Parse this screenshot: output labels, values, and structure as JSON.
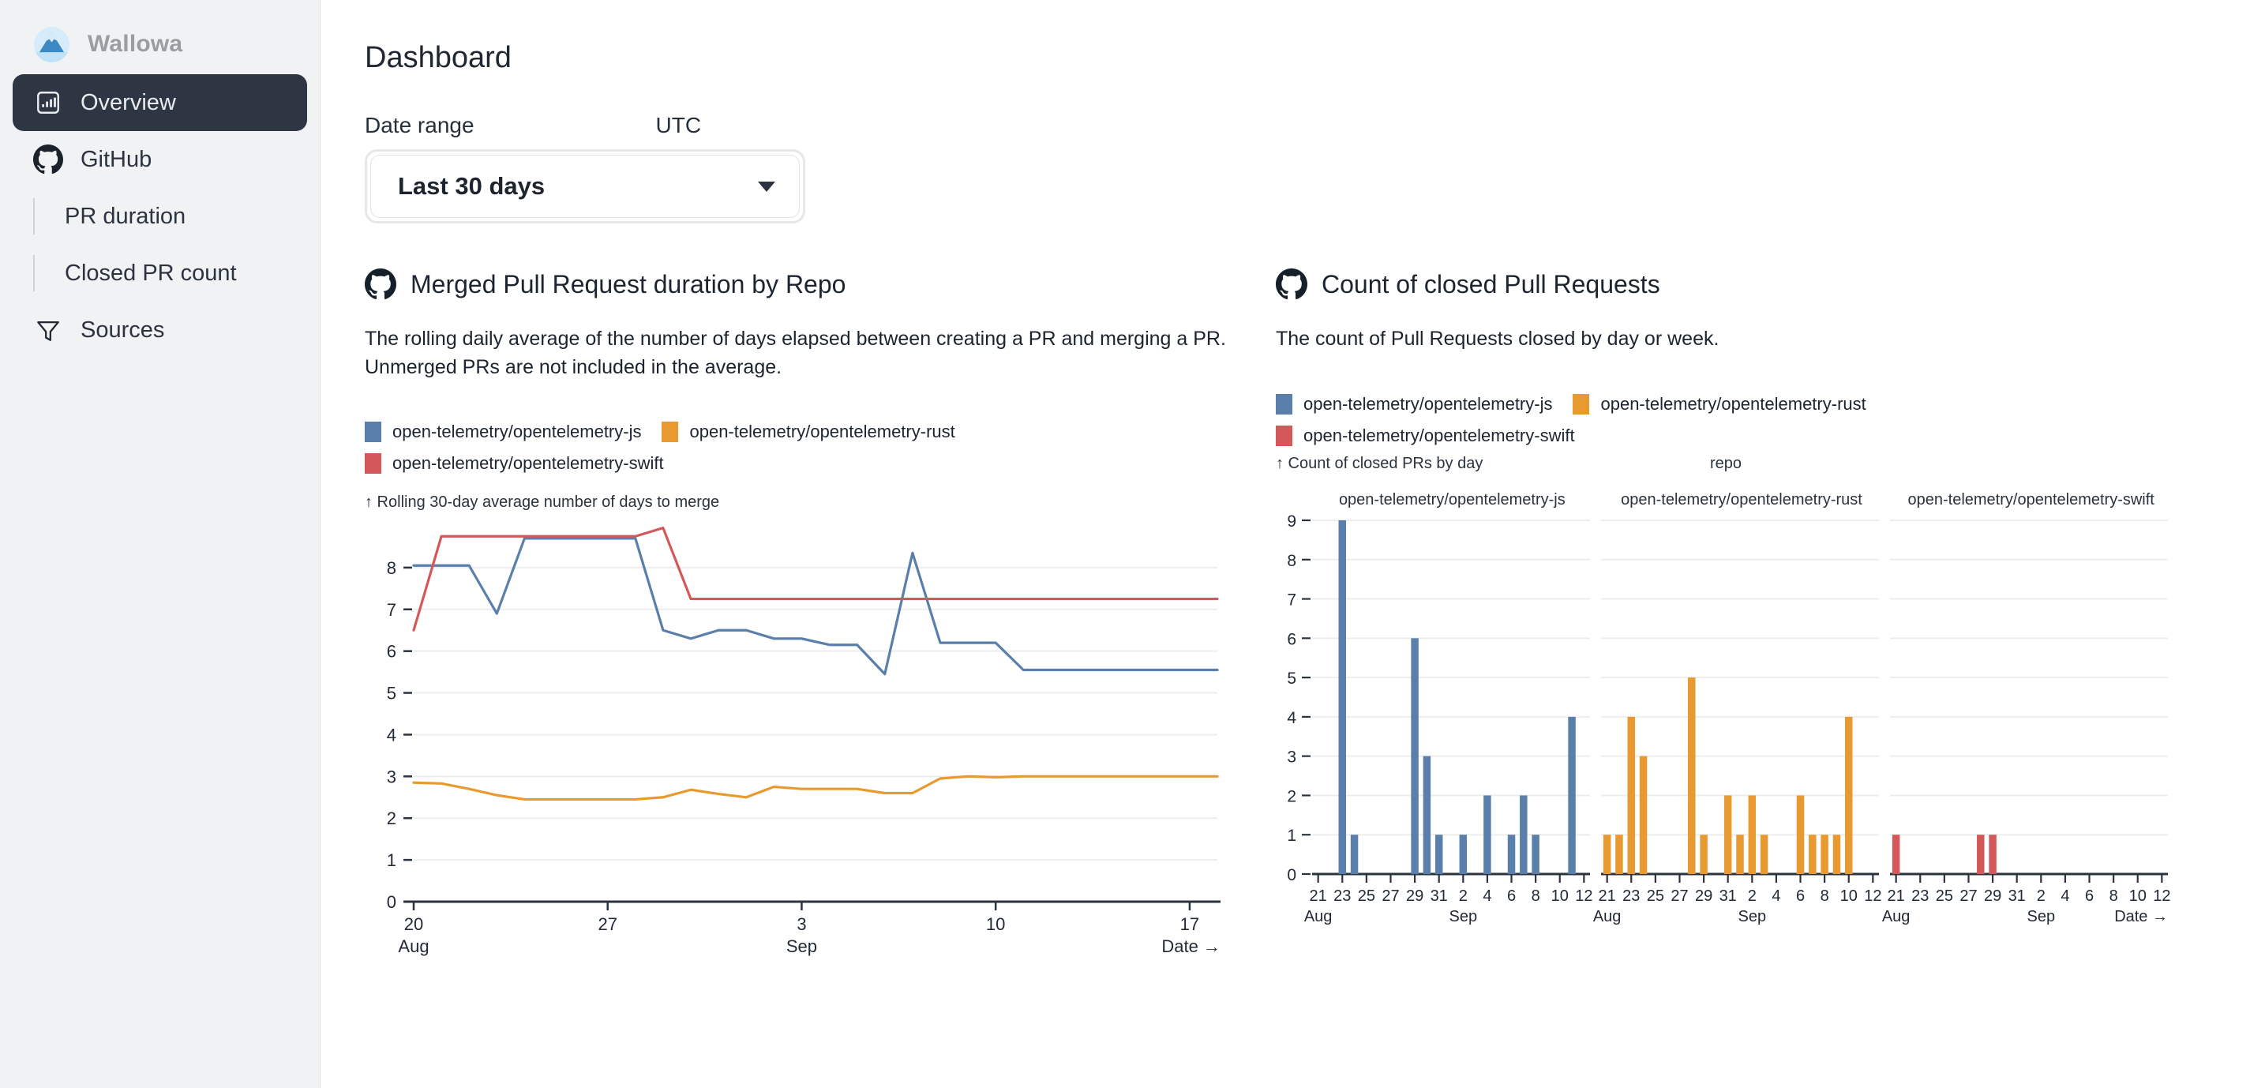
{
  "sidebar": {
    "brand": {
      "name": "Wallowa",
      "logo_icon": "mountain-logo-icon"
    },
    "items": [
      {
        "label": "Overview",
        "icon": "bar-chart-icon",
        "active": true,
        "type": "item"
      },
      {
        "label": "GitHub",
        "icon": "github-icon",
        "active": false,
        "type": "item"
      },
      {
        "label": "PR duration",
        "type": "sub"
      },
      {
        "label": "Closed PR count",
        "type": "sub"
      },
      {
        "label": "Sources",
        "icon": "funnel-icon",
        "active": false,
        "type": "item"
      }
    ]
  },
  "header": {
    "title": "Dashboard"
  },
  "filters": {
    "date_range_label": "Date range",
    "timezone_label": "UTC",
    "date_range_value": "Last 30 days",
    "caret_icon": "chevron-down-icon"
  },
  "colors": {
    "js": "#5b7fab",
    "rust": "#e8992f",
    "swift": "#d4585a",
    "sidebar_bg": "#f1f2f3",
    "active_nav_bg": "#2e3643",
    "text": "#1c242f",
    "grid": "#ededed",
    "axis": "#2b3340"
  },
  "panel_left": {
    "icon": "github-icon",
    "title": "Merged Pull Request duration by Repo",
    "description": "The rolling daily average of the number of days elapsed between creating a PR and merging a PR. Unmerged PRs are not included in the average."
  },
  "panel_right": {
    "icon": "github-icon",
    "title": "Count of closed Pull Requests",
    "description": "The count of Pull Requests closed by day or week."
  },
  "legend": [
    {
      "label": "open-telemetry/opentelemetry-js",
      "color": "#5b7fab"
    },
    {
      "label": "open-telemetry/opentelemetry-rust",
      "color": "#e8992f"
    },
    {
      "label": "open-telemetry/opentelemetry-swift",
      "color": "#d4585a"
    }
  ],
  "chart_data": [
    {
      "id": "merged-pr-duration",
      "type": "line",
      "title": "Merged Pull Request duration by Repo",
      "ylabel": "↑ Rolling 30-day average number of days to merge",
      "xlabel": "Date →",
      "ylim": [
        0,
        9
      ],
      "yticks": [
        0,
        1,
        2,
        3,
        4,
        5,
        6,
        7,
        8
      ],
      "grid": true,
      "x": [
        "Aug 20",
        "Aug 21",
        "Aug 22",
        "Aug 23",
        "Aug 24",
        "Aug 25",
        "Aug 26",
        "Aug 27",
        "Aug 28",
        "Aug 29",
        "Aug 30",
        "Aug 31",
        "Sep 1",
        "Sep 2",
        "Sep 3",
        "Sep 4",
        "Sep 5",
        "Sep 6",
        "Sep 7",
        "Sep 8",
        "Sep 9",
        "Sep 10",
        "Sep 11",
        "Sep 12",
        "Sep 13",
        "Sep 14",
        "Sep 15",
        "Sep 16",
        "Sep 17",
        "Sep 18"
      ],
      "xticks": [
        {
          "label": "20",
          "sub": "Aug"
        },
        {
          "label": "27",
          "sub": ""
        },
        {
          "label": "3",
          "sub": "Sep"
        },
        {
          "label": "10",
          "sub": ""
        },
        {
          "label": "17",
          "sub": ""
        }
      ],
      "series": [
        {
          "name": "open-telemetry/opentelemetry-js",
          "color": "#5b7fab",
          "values": [
            8.05,
            8.05,
            8.05,
            6.9,
            8.7,
            8.7,
            8.7,
            8.7,
            8.7,
            6.5,
            6.3,
            6.5,
            6.5,
            6.3,
            6.3,
            6.15,
            6.15,
            5.45,
            8.35,
            6.2,
            6.2,
            6.2,
            5.55,
            5.55,
            5.55,
            5.55,
            5.55,
            5.55,
            5.55,
            5.55
          ]
        },
        {
          "name": "open-telemetry/opentelemetry-rust",
          "color": "#e8992f",
          "values": [
            2.85,
            2.83,
            2.7,
            2.55,
            2.45,
            2.45,
            2.45,
            2.45,
            2.45,
            2.5,
            2.68,
            2.58,
            2.5,
            2.75,
            2.7,
            2.7,
            2.7,
            2.6,
            2.6,
            2.95,
            3.0,
            2.98,
            3.0,
            3.0,
            3.0,
            3.0,
            3.0,
            3.0,
            3.0,
            3.0
          ]
        },
        {
          "name": "open-telemetry/opentelemetry-swift",
          "color": "#d4585a",
          "values": [
            6.5,
            8.75,
            8.75,
            8.75,
            8.75,
            8.75,
            8.75,
            8.75,
            8.75,
            8.95,
            7.25,
            7.25,
            7.25,
            7.25,
            7.25,
            7.25,
            7.25,
            7.25,
            7.25,
            7.25,
            7.25,
            7.25,
            7.25,
            7.25,
            7.25,
            7.25,
            7.25,
            7.25,
            7.25,
            7.25
          ]
        }
      ]
    },
    {
      "id": "closed-pr-count",
      "type": "bar",
      "title": "Count of closed Pull Requests",
      "ylabel": "↑ Count of closed PRs by day",
      "xlabel": "Date →",
      "facet_label": "repo",
      "ylim": [
        0,
        9
      ],
      "yticks": [
        0,
        1,
        2,
        3,
        4,
        5,
        6,
        7,
        8,
        9
      ],
      "grid": true,
      "categories": [
        "21",
        "22",
        "23",
        "24",
        "25",
        "26",
        "27",
        "28",
        "29",
        "30",
        "31",
        "1",
        "2",
        "3",
        "4",
        "5",
        "6",
        "7",
        "8",
        "9",
        "10",
        "11",
        "12"
      ],
      "xticks": [
        {
          "label": "21",
          "sub": "Aug"
        },
        {
          "label": "23",
          "sub": ""
        },
        {
          "label": "25",
          "sub": ""
        },
        {
          "label": "27",
          "sub": ""
        },
        {
          "label": "29",
          "sub": ""
        },
        {
          "label": "31",
          "sub": ""
        },
        {
          "label": "2",
          "sub": "Sep"
        },
        {
          "label": "4",
          "sub": ""
        },
        {
          "label": "6",
          "sub": ""
        },
        {
          "label": "8",
          "sub": ""
        },
        {
          "label": "10",
          "sub": ""
        },
        {
          "label": "12",
          "sub": ""
        }
      ],
      "facets": [
        {
          "name": "open-telemetry/opentelemetry-js",
          "color": "#5b7fab",
          "values": [
            0,
            0,
            9,
            1,
            0,
            0,
            0,
            0,
            6,
            3,
            1,
            0,
            1,
            0,
            2,
            0,
            1,
            2,
            1,
            0,
            0,
            4,
            0
          ]
        },
        {
          "name": "open-telemetry/opentelemetry-rust",
          "color": "#e8992f",
          "values": [
            1,
            1,
            4,
            3,
            0,
            0,
            0,
            5,
            1,
            0,
            2,
            1,
            2,
            1,
            0,
            0,
            2,
            1,
            1,
            1,
            4,
            0,
            0
          ]
        },
        {
          "name": "open-telemetry/opentelemetry-swift",
          "color": "#d4585a",
          "values": [
            1,
            0,
            0,
            0,
            0,
            0,
            0,
            1,
            1,
            0,
            0,
            0,
            0,
            0,
            0,
            0,
            0,
            0,
            0,
            0,
            0,
            0,
            0
          ]
        }
      ]
    }
  ]
}
